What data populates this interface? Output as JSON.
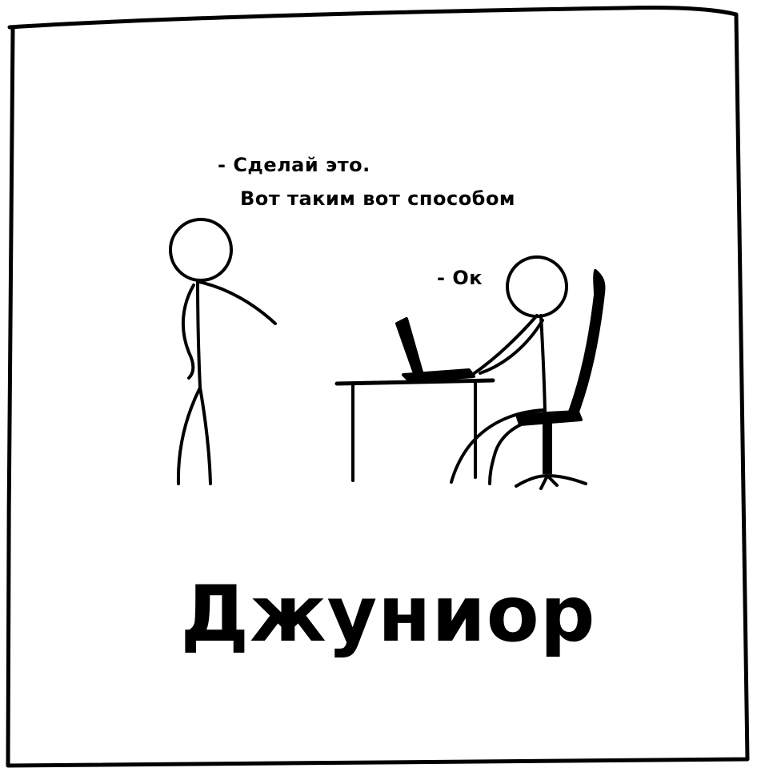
{
  "speech": {
    "instructor_line_1": "- Сделай это.",
    "instructor_line_2": "Вот таким вот способом",
    "junior_reply": "- Ок"
  },
  "caption": "Джуниор",
  "colors": {
    "ink": "#000000",
    "paper": "#ffffff"
  }
}
